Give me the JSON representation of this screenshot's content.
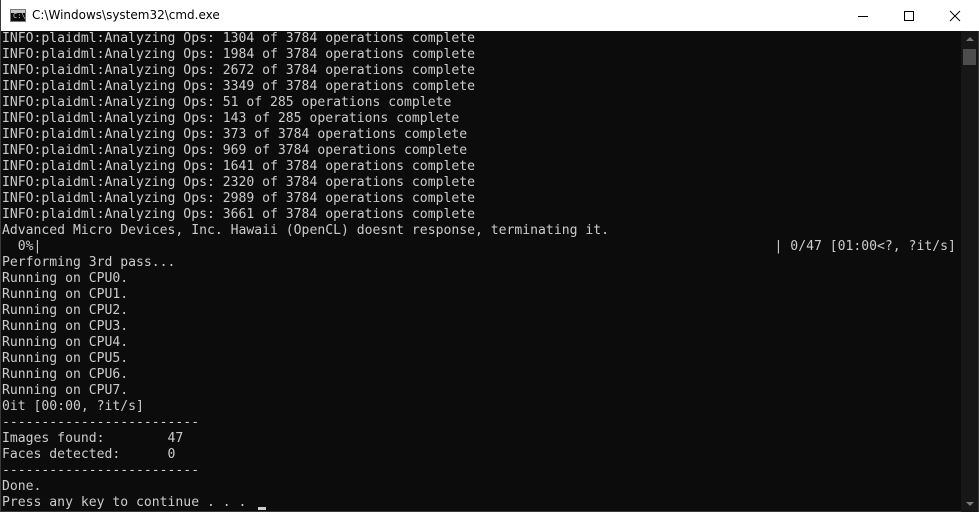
{
  "window": {
    "title": "C:\\Windows\\system32\\cmd.exe",
    "icon": "cmd-icon",
    "icon_prompt": "C:\\"
  },
  "console": {
    "lines": [
      "INFO:plaidml:Analyzing Ops: 1304 of 3784 operations complete",
      "INFO:plaidml:Analyzing Ops: 1984 of 3784 operations complete",
      "INFO:plaidml:Analyzing Ops: 2672 of 3784 operations complete",
      "INFO:plaidml:Analyzing Ops: 3349 of 3784 operations complete",
      "INFO:plaidml:Analyzing Ops: 51 of 285 operations complete",
      "INFO:plaidml:Analyzing Ops: 143 of 285 operations complete",
      "INFO:plaidml:Analyzing Ops: 373 of 3784 operations complete",
      "INFO:plaidml:Analyzing Ops: 969 of 3784 operations complete",
      "INFO:plaidml:Analyzing Ops: 1641 of 3784 operations complete",
      "INFO:plaidml:Analyzing Ops: 2320 of 3784 operations complete",
      "INFO:plaidml:Analyzing Ops: 2989 of 3784 operations complete",
      "INFO:plaidml:Analyzing Ops: 3661 of 3784 operations complete",
      "Advanced Micro Devices, Inc. Hawaii (OpenCL) doesnt response, terminating it.",
      "  0%|                                                                                             | 0/47 [01:00<?, ?it/s]",
      "Performing 3rd pass...",
      "Running on CPU0.",
      "Running on CPU1.",
      "Running on CPU2.",
      "Running on CPU3.",
      "Running on CPU4.",
      "Running on CPU5.",
      "Running on CPU6.",
      "Running on CPU7.",
      "0it [00:00, ?it/s]",
      "-------------------------",
      "Images found:        47",
      "Faces detected:      0",
      "-------------------------",
      "Done.",
      "Press any key to continue . . ."
    ],
    "text_color": "#cccccc",
    "background": "#0c0c0c"
  },
  "scrollbar": {
    "up_icon": "scroll-up-arrow-icon",
    "down_icon": "scroll-down-arrow-icon"
  }
}
